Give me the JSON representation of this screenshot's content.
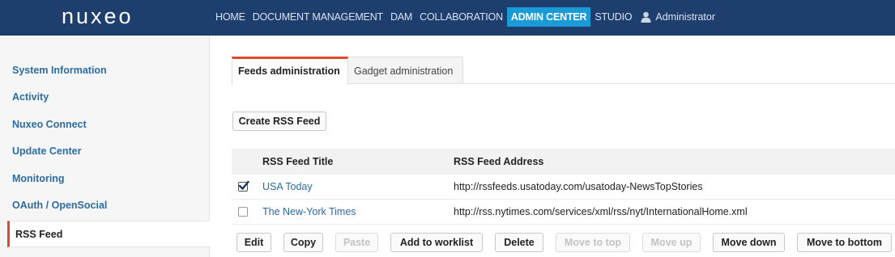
{
  "header": {
    "logo": "nuxeo",
    "nav": [
      "HOME",
      "DOCUMENT MANAGEMENT",
      "DAM",
      "COLLABORATION",
      "ADMIN CENTER",
      "STUDIO"
    ],
    "active_nav": "ADMIN CENTER",
    "user": "Administrator",
    "colors": {
      "bar": "#1e3f6e",
      "active": "#1a9bd7"
    }
  },
  "sidebar": {
    "items": [
      "System Information",
      "Activity",
      "Nuxeo Connect",
      "Update Center",
      "Monitoring",
      "OAuth / OpenSocial",
      "RSS Feed"
    ],
    "active": "RSS Feed"
  },
  "tabs": {
    "items": [
      "Feeds administration",
      "Gadget administration"
    ],
    "active": "Feeds administration"
  },
  "create_button": "Create RSS Feed",
  "table": {
    "headers": [
      "RSS Feed Title",
      "RSS Feed Address"
    ],
    "rows": [
      {
        "checked": true,
        "title": "USA Today",
        "address": "http://rssfeeds.usatoday.com/usatoday-NewsTopStories"
      },
      {
        "checked": false,
        "title": "The New-York Times",
        "address": "http://rss.nytimes.com/services/xml/rss/nyt/InternationalHome.xml"
      }
    ]
  },
  "actions": {
    "edit": "Edit",
    "copy": "Copy",
    "paste": "Paste",
    "add_to_worklist": "Add to worklist",
    "delete": "Delete",
    "move_to_top": "Move to top",
    "move_up": "Move up",
    "move_down": "Move down",
    "move_to_bottom": "Move to bottom",
    "disabled": [
      "Paste",
      "Move to top",
      "Move up"
    ]
  }
}
